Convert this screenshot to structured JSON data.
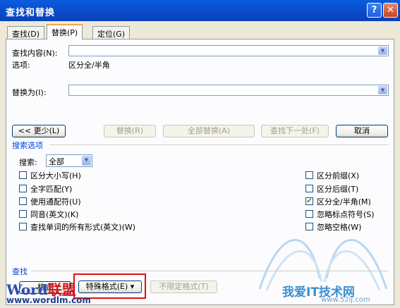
{
  "window": {
    "title": "查找和替换",
    "help_glyph": "?",
    "close_glyph": "✕"
  },
  "tabs": [
    {
      "label": "查找(D)"
    },
    {
      "label": "替换(P)"
    },
    {
      "label": "定位(G)"
    }
  ],
  "find": {
    "label": "查找内容(N):",
    "value": ""
  },
  "options": {
    "label": "选项:",
    "value": "区分全/半角"
  },
  "replace": {
    "label": "替换为(I):",
    "value": ""
  },
  "buttons": {
    "less": "<< 更少(L)",
    "replace": "替换(R)",
    "replace_all": "全部替换(A)",
    "find_next": "查找下一处(F)",
    "cancel": "取消"
  },
  "search_options": {
    "title": "搜索选项",
    "search_label": "搜索:",
    "search_value": "全部",
    "left": [
      {
        "label": "区分大小写(H)",
        "checked": false
      },
      {
        "label": "全字匹配(Y)",
        "checked": false
      },
      {
        "label": "使用通配符(U)",
        "checked": false
      },
      {
        "label": "同音(英文)(K)",
        "checked": false
      },
      {
        "label": "查找单词的所有形式(英文)(W)",
        "checked": false
      }
    ],
    "right": [
      {
        "label": "区分前缀(X)",
        "checked": false
      },
      {
        "label": "区分后缀(T)",
        "checked": false
      },
      {
        "label": "区分全/半角(M)",
        "checked": true
      },
      {
        "label": "忽略标点符号(S)",
        "checked": false
      },
      {
        "label": "忽略空格(W)",
        "checked": false
      }
    ]
  },
  "find_section": {
    "title": "查找",
    "format": "格式",
    "special": "特殊格式(E) ▾",
    "no_format": "不限定格式(T)"
  },
  "watermarks": {
    "logo_part1": "Word",
    "logo_part2": "联盟",
    "url": "www.wordlm.com",
    "site_title": "我爱IT技术网",
    "site_url": "www.52ij.com"
  },
  "colors": {
    "title_bar": "#0a5ddf",
    "accent_highlight": "#e01010",
    "group_title": "#0046d5"
  }
}
